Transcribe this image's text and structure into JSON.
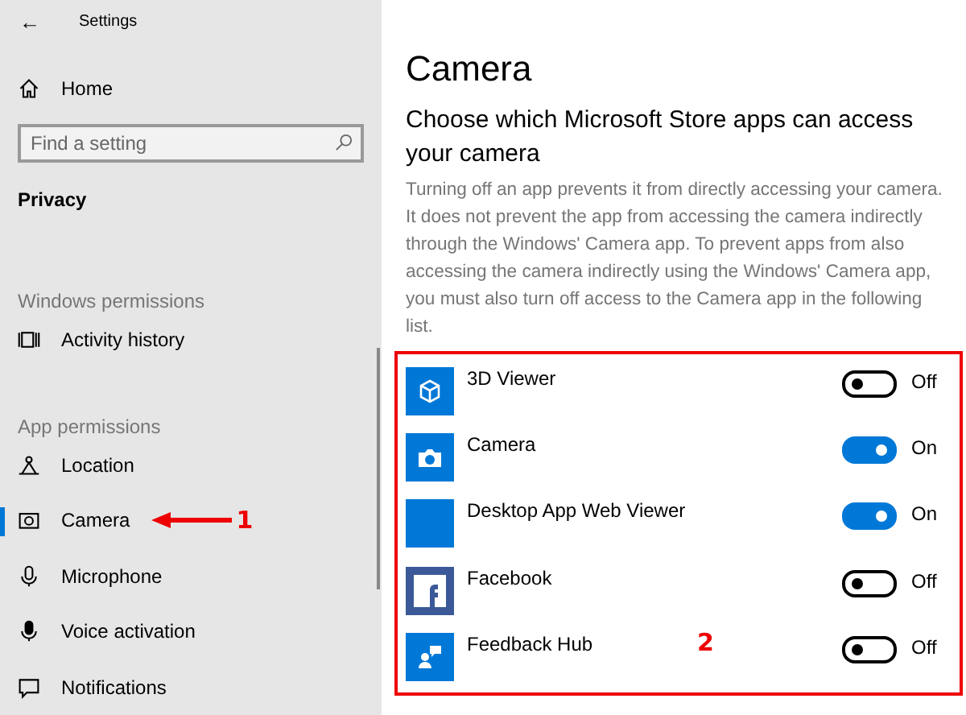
{
  "window": {
    "title": "Settings",
    "back": "←"
  },
  "sidebar": {
    "home": "Home",
    "search": {
      "placeholder": "Find a setting"
    },
    "section": "Privacy",
    "groups": [
      {
        "heading": "Windows permissions",
        "items": [
          {
            "label": "Activity history",
            "selected": false
          }
        ]
      },
      {
        "heading": "App permissions",
        "items": [
          {
            "label": "Location",
            "selected": false
          },
          {
            "label": "Camera",
            "selected": true
          },
          {
            "label": "Microphone",
            "selected": false
          },
          {
            "label": "Voice activation",
            "selected": false
          },
          {
            "label": "Notifications",
            "selected": false
          }
        ]
      }
    ]
  },
  "page": {
    "title": "Camera",
    "subtitle": "Choose which Microsoft Store apps can access your camera",
    "description": "Turning off an app prevents it from directly accessing your camera. It does not prevent the app from accessing the camera indirectly through the Windows' Camera app. To prevent apps from also accessing the camera indirectly using the Windows' Camera app, you must also turn off access to the Camera app in the following list.",
    "apps": [
      {
        "name": "3D Viewer",
        "on": false,
        "state": "Off"
      },
      {
        "name": "Camera",
        "on": true,
        "state": "On"
      },
      {
        "name": "Desktop App Web Viewer",
        "on": true,
        "state": "On"
      },
      {
        "name": "Facebook",
        "on": false,
        "state": "Off"
      },
      {
        "name": "Feedback Hub",
        "on": false,
        "state": "Off"
      }
    ]
  },
  "annotations": [
    {
      "label": "1"
    },
    {
      "label": "2"
    }
  ]
}
